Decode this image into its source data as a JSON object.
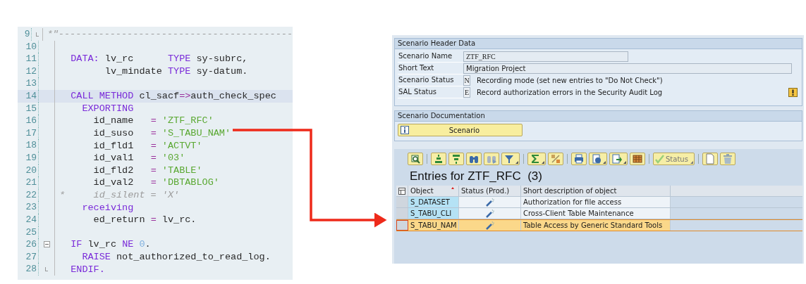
{
  "editor": {
    "lines": [
      {
        "number": "9",
        "block_end": true,
        "highlighted": false,
        "tokens": [
          {
            "kind": "comment",
            "text": "*\"-----------------------------------------"
          }
        ]
      },
      {
        "number": "10",
        "highlighted": false
      },
      {
        "number": "11",
        "highlighted": false,
        "tokens": [
          {
            "kind": "keyword",
            "text": "  DATA:"
          },
          {
            "kind": "plain",
            "text": " lv_rc      "
          },
          {
            "kind": "keyword",
            "text": "TYPE"
          },
          {
            "kind": "plain",
            "text": " sy-subrc,"
          }
        ]
      },
      {
        "number": "12",
        "highlighted": false,
        "tokens": [
          {
            "kind": "plain",
            "text": "        lv_mindate "
          },
          {
            "kind": "keyword",
            "text": "TYPE"
          },
          {
            "kind": "plain",
            "text": " sy-datum."
          }
        ]
      },
      {
        "number": "13",
        "highlighted": false
      },
      {
        "number": "14",
        "highlighted": true,
        "tokens": [
          {
            "kind": "keyword",
            "text": "  CALL METHOD"
          },
          {
            "kind": "plain",
            "text": " cl_sacf"
          },
          {
            "kind": "operator",
            "text": "=>"
          },
          {
            "kind": "plain",
            "text": "auth_check_spec"
          }
        ]
      },
      {
        "number": "15",
        "highlighted": false,
        "tokens": [
          {
            "kind": "keyword",
            "text": "    EXPORTING"
          }
        ]
      },
      {
        "number": "16",
        "highlighted": false,
        "tokens": [
          {
            "kind": "plain",
            "text": "      id_name   "
          },
          {
            "kind": "operator",
            "text": "="
          },
          {
            "kind": "string",
            "text": " 'ZTF_RFC'"
          }
        ]
      },
      {
        "number": "17",
        "highlighted": false,
        "tokens": [
          {
            "kind": "plain",
            "text": "      id_suso   "
          },
          {
            "kind": "operator",
            "text": "="
          },
          {
            "kind": "string",
            "text": " 'S_TABU_NAM'"
          }
        ]
      },
      {
        "number": "18",
        "highlighted": false,
        "tokens": [
          {
            "kind": "plain",
            "text": "      id_fld1   "
          },
          {
            "kind": "operator",
            "text": "="
          },
          {
            "kind": "string",
            "text": " 'ACTVT'"
          }
        ]
      },
      {
        "number": "19",
        "highlighted": false,
        "tokens": [
          {
            "kind": "plain",
            "text": "      id_val1   "
          },
          {
            "kind": "operator",
            "text": "="
          },
          {
            "kind": "string",
            "text": " '03'"
          }
        ]
      },
      {
        "number": "20",
        "highlighted": false,
        "tokens": [
          {
            "kind": "plain",
            "text": "      id_fld2   "
          },
          {
            "kind": "operator",
            "text": "="
          },
          {
            "kind": "string",
            "text": " 'TABLE'"
          }
        ]
      },
      {
        "number": "21",
        "highlighted": false,
        "tokens": [
          {
            "kind": "plain",
            "text": "      id_val2   "
          },
          {
            "kind": "operator",
            "text": "="
          },
          {
            "kind": "string",
            "text": " 'DBTABLOG'"
          }
        ]
      },
      {
        "number": "22",
        "highlighted": false,
        "tokens": [
          {
            "kind": "comment",
            "text": "*     id_silent = 'X'"
          }
        ]
      },
      {
        "number": "23",
        "highlighted": false,
        "tokens": [
          {
            "kind": "keyword",
            "text": "    receiving"
          }
        ]
      },
      {
        "number": "24",
        "highlighted": false,
        "tokens": [
          {
            "kind": "plain",
            "text": "      ed_return "
          },
          {
            "kind": "operator",
            "text": "="
          },
          {
            "kind": "plain",
            "text": " lv_rc."
          }
        ]
      },
      {
        "number": "25",
        "highlighted": false
      },
      {
        "number": "26",
        "collapsible": true,
        "highlighted": false,
        "tokens": [
          {
            "kind": "keyword",
            "text": "  IF"
          },
          {
            "kind": "plain",
            "text": " lv_rc "
          },
          {
            "kind": "keyword",
            "text": "NE"
          },
          {
            "kind": "number",
            "text": " 0"
          },
          {
            "kind": "plain",
            "text": "."
          }
        ]
      },
      {
        "number": "27",
        "highlighted": false,
        "tokens": [
          {
            "kind": "keyword",
            "text": "    RAISE"
          },
          {
            "kind": "plain",
            "text": " not_authorized_to_read_log."
          }
        ]
      },
      {
        "number": "28",
        "block_end": true,
        "highlighted": false,
        "tokens": [
          {
            "kind": "keyword",
            "text": "  ENDIF."
          }
        ]
      }
    ]
  },
  "scenario_header": {
    "title": "Scenario Header Data",
    "fields": [
      {
        "label": "Scenario Name",
        "kind": "short_input",
        "value": "ZTF_RFC",
        "warning": false
      },
      {
        "label": "Short Text",
        "kind": "long_input",
        "value": "Migration Project",
        "warning": false
      },
      {
        "label": "Scenario Status",
        "kind": "code",
        "code": "N",
        "description": "Recording mode (set new entries to \"Do Not Check\")",
        "warning": false
      },
      {
        "label": "SAL Status",
        "kind": "code",
        "code": "E",
        "description": "Record authorization errors in the Security Audit Log",
        "warning": true
      }
    ]
  },
  "documentation": {
    "title": "Scenario Documentation",
    "button": "Scenario"
  },
  "toolbar": {
    "status_button": "Status"
  },
  "entries": {
    "title": "Entries for ZTF_RFC  (3)",
    "columns": [
      {
        "label": "Object",
        "sorted": true
      },
      {
        "label": "Status (Prod.)",
        "sorted": false
      },
      {
        "label": "Short description of object",
        "sorted": false
      }
    ],
    "rows": [
      {
        "object": "S_DATASET",
        "description": "Authorization for file access",
        "selected": false
      },
      {
        "object": "S_TABU_CLI",
        "description": "Cross-Client Table Maintenance",
        "selected": false
      },
      {
        "object": "S_TABU_NAM",
        "description": "Table Access by Generic Standard Tools",
        "selected": true
      }
    ]
  }
}
